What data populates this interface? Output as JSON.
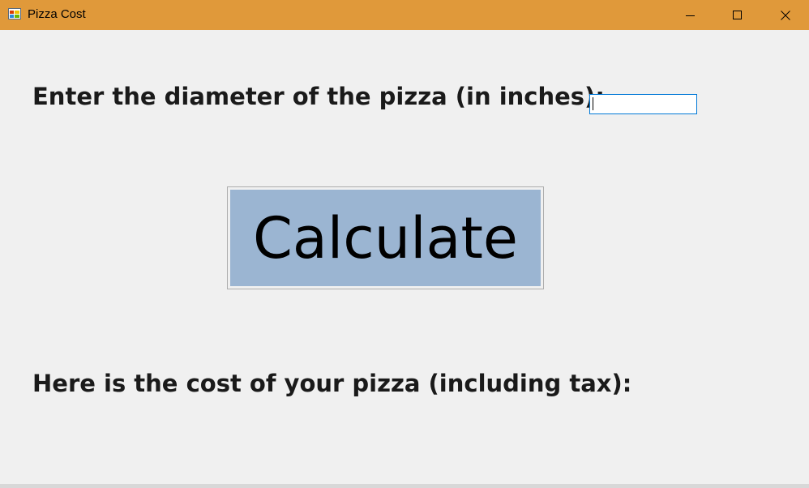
{
  "window": {
    "title": "Pizza Cost",
    "icons": {
      "app": "app-icon",
      "minimize": "minimize-icon",
      "maximize": "maximize-icon",
      "close": "close-icon"
    },
    "title_bar_color": "#e0993a"
  },
  "form": {
    "prompt_label": "Enter the diameter of the pizza (in inches):",
    "diameter_value": "",
    "calculate_label": "Calculate",
    "calculate_color": "#9bb5d2",
    "result_label": "Here is the cost of your pizza (including tax):"
  }
}
